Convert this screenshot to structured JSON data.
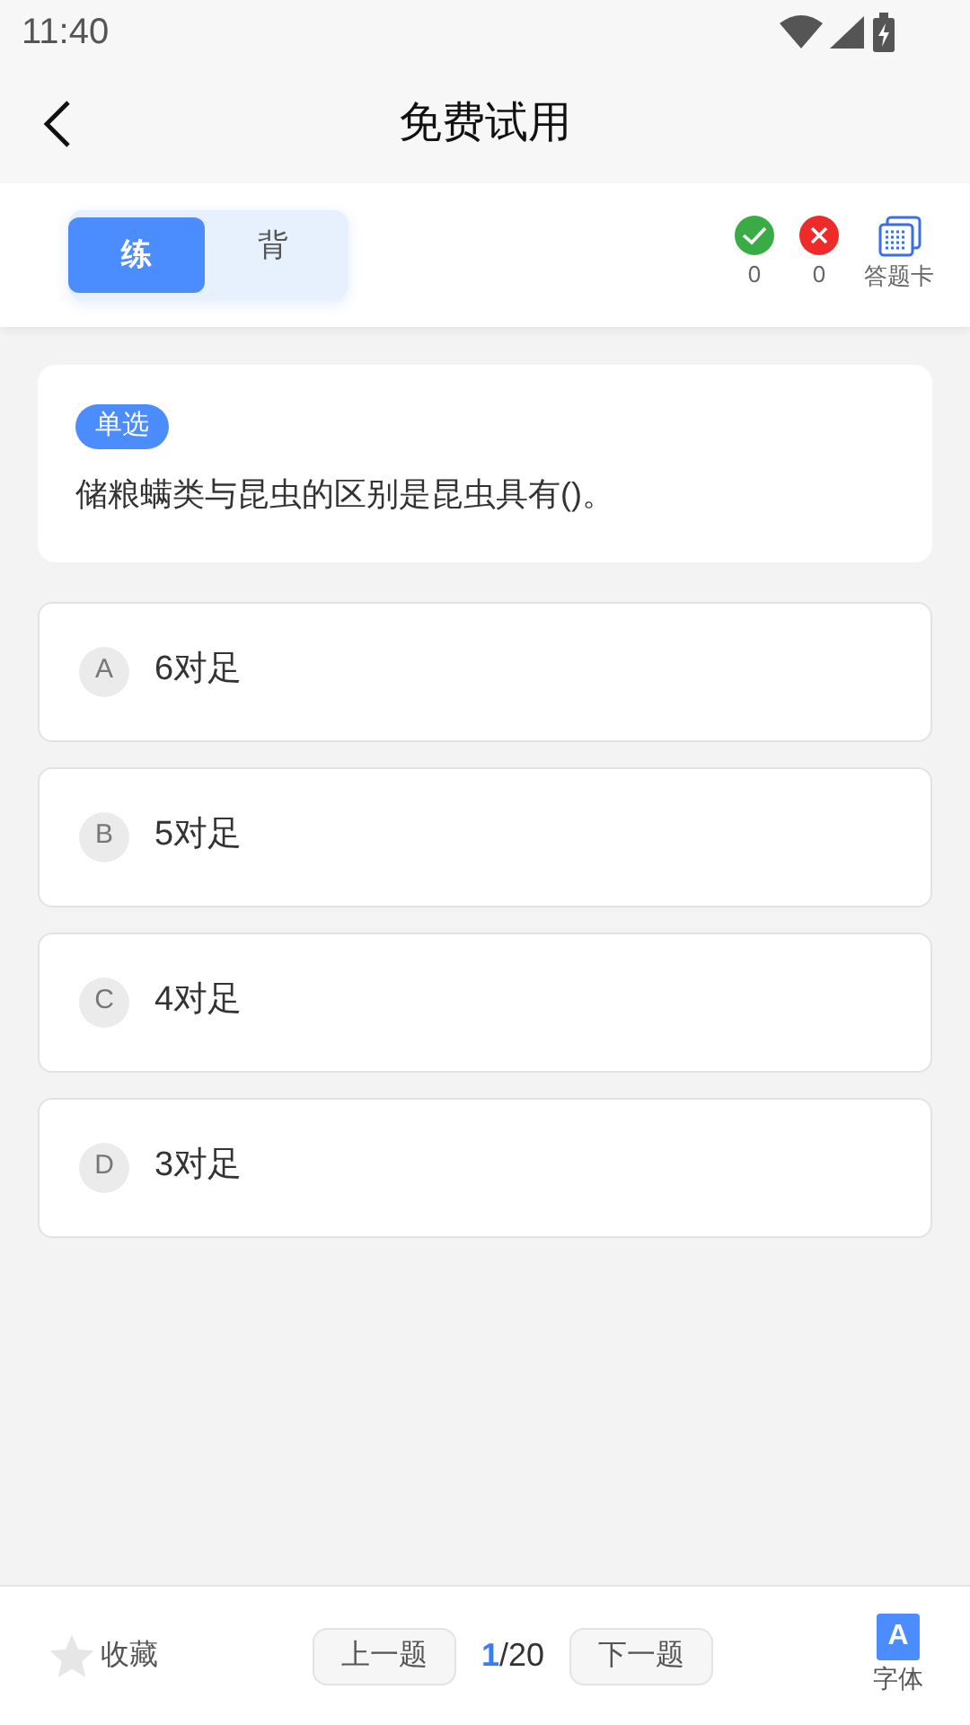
{
  "status_bar": {
    "time": "11:40"
  },
  "header": {
    "title": "免费试用"
  },
  "mode_tabs": [
    {
      "label": "练",
      "selected": true
    },
    {
      "label": "背",
      "selected": false
    }
  ],
  "stats": {
    "correct": "0",
    "wrong": "0",
    "answer_card": "答题卡"
  },
  "question": {
    "type": "单选",
    "text": "储粮螨类与昆虫的区别是昆虫具有()。"
  },
  "options": [
    {
      "letter": "A",
      "text": "6对足",
      "selected": false
    },
    {
      "letter": "B",
      "text": "5对足",
      "selected": false
    },
    {
      "letter": "C",
      "text": "4对足",
      "selected": false
    },
    {
      "letter": "D",
      "text": "3对足",
      "selected": false
    }
  ],
  "footer": {
    "favorite": {
      "label": "收藏",
      "checked": false
    },
    "prev": "上一题",
    "current": "1",
    "total": "/20",
    "next": "下一题",
    "font_icon": "A",
    "font": "字体"
  }
}
